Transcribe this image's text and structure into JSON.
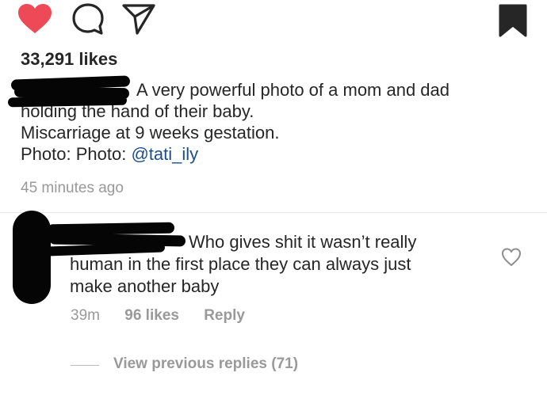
{
  "actions": {
    "like_icon": "heart-filled-icon",
    "comment_icon": "comment-bubble-icon",
    "share_icon": "paper-plane-icon",
    "save_icon": "bookmark-filled-icon",
    "like_color": "#ed4956"
  },
  "post": {
    "likes": "33,291 likes",
    "caption_lines": [
      "A very powerful photo of a mom and dad",
      "holding the hand of their baby.",
      "Miscarriage at 9 weeks gestation."
    ],
    "credit_prefix": "Photo: Photo: ",
    "credit_handle": "@tati_ily",
    "mention_color": "#1b4f8a",
    "timestamp": "45 minutes ago"
  },
  "comment": {
    "lines": [
      "Who gives shit it wasn’t really",
      "human in the first place they can always just",
      "make another baby"
    ],
    "age": "39m",
    "likes": "96 likes",
    "reply_label": "Reply",
    "like_icon": "heart-outline-icon"
  },
  "replies": {
    "label": "View previous replies (71)"
  }
}
